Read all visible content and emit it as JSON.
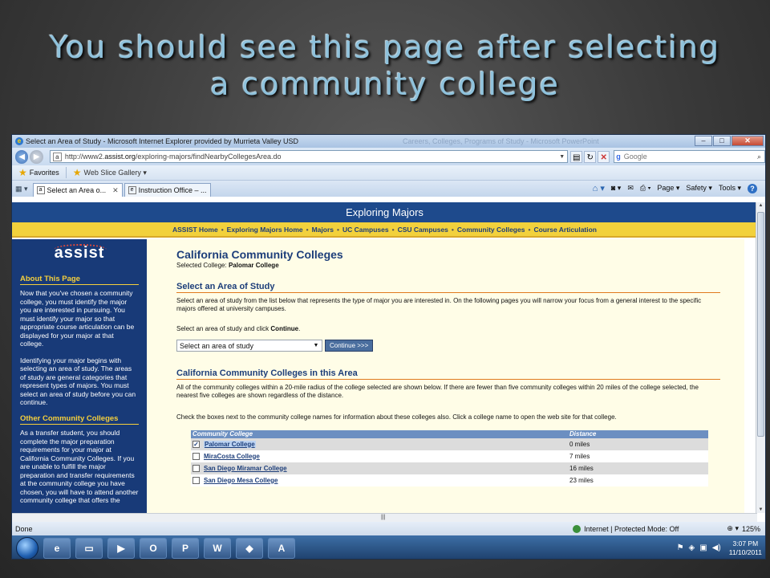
{
  "slide": {
    "title_line1": "You should see this page after selecting",
    "title_line2": "a community college"
  },
  "browser": {
    "window_title": "Select an Area of Study - Microsoft Internet Explorer provided by Murrieta Valley USD",
    "ghost_title": "Careers, Colleges, Programs of Study - Microsoft PowerPoint",
    "url_prefix": "http://www2.",
    "url_domain": "assist.org",
    "url_path": "/exploring-majors/findNearbyCollegesArea.do",
    "search_brand": "Google",
    "favorites_label": "Favorites",
    "web_slice_label": "Web Slice Gallery ▾",
    "tabs": [
      {
        "label": "Select an Area o...",
        "active": true
      },
      {
        "label": "Instruction Office – ...",
        "active": false
      }
    ],
    "commands": {
      "page": "Page ▾",
      "safety": "Safety ▾",
      "tools": "Tools ▾"
    },
    "status_left": "Done",
    "status_zone": "Internet | Protected Mode: Off",
    "zoom": "125%"
  },
  "site": {
    "banner": "Exploring Majors",
    "nav": [
      "ASSIST Home",
      "Exploring Majors Home",
      "Majors",
      "UC Campuses",
      "CSU Campuses",
      "Community Colleges",
      "Course Articulation"
    ],
    "nav_separator": "•",
    "logo_text": "assist",
    "sidebar": {
      "about_heading": "About This Page",
      "about_p1": "Now that you've chosen a community college, you must identify the major you are interested in pursuing. You must identify your major so that appropriate course articulation can be displayed for your major at that college.",
      "about_p2": "Identifying your major begins with selecting an area of study. The areas of study are general categories that represent types of majors. You must select an area of study before you can continue.",
      "other_heading": "Other Community Colleges",
      "other_p1": "As a transfer student, you should complete the major preparation requirements for your major at California Community Colleges. If you are unable to fulfill the major preparation and transfer requirements at the community college you have chosen, you will have to attend another community college that offers the"
    },
    "main": {
      "title": "California Community Colleges",
      "selected_label": "Selected College:",
      "selected_value": "Palomar College",
      "area_heading": "Select an Area of Study",
      "area_desc": "Select an area of study from the list below that represents the type of major you are interested in. On the following pages you will narrow your focus from a general interest to the specific majors offered at university campuses.",
      "instruction_prefix": "Select an area of study and click ",
      "instruction_bold": "Continue",
      "instruction_suffix": ".",
      "select_value": "Select an area of study",
      "continue_button": "Continue >>>",
      "nearby_heading": "California Community Colleges in this Area",
      "nearby_desc": "All of the community colleges within a 20-mile radius of the college selected are shown below. If there are fewer than five community colleges within 20 miles of the college selected, the nearest five colleges are shown regardless of the distance.",
      "checkbox_desc": "Check the boxes next to the community college names for information about these colleges also. Click a college name to open the web site for that college.",
      "table_headers": [
        "Community College",
        "Distance"
      ],
      "colleges": [
        {
          "name": "Palomar College",
          "distance": "0 miles",
          "checked": true
        },
        {
          "name": "MiraCosta College",
          "distance": "7 miles",
          "checked": false
        },
        {
          "name": "San Diego Miramar College",
          "distance": "16 miles",
          "checked": false
        },
        {
          "name": "San Diego Mesa College",
          "distance": "23 miles",
          "checked": false
        }
      ]
    }
  },
  "taskbar": {
    "time": "3:07 PM",
    "date": "11/10/2011"
  }
}
